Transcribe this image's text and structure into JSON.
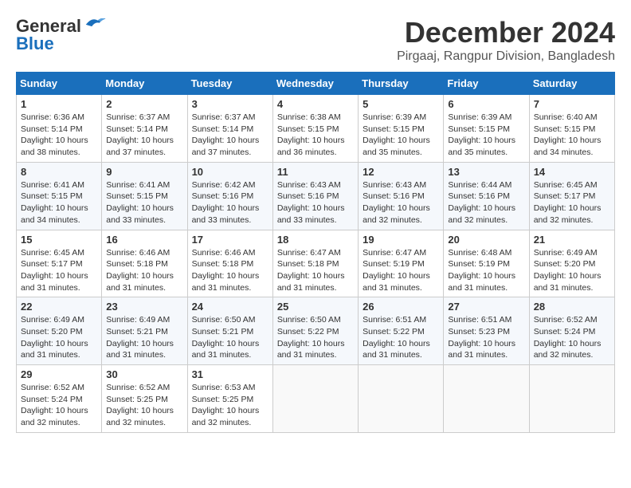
{
  "logo": {
    "line1": "General",
    "line2": "Blue"
  },
  "title": "December 2024",
  "location": "Pirgaaj, Rangpur Division, Bangladesh",
  "weekdays": [
    "Sunday",
    "Monday",
    "Tuesday",
    "Wednesday",
    "Thursday",
    "Friday",
    "Saturday"
  ],
  "weeks": [
    [
      {
        "day": "1",
        "info": "Sunrise: 6:36 AM\nSunset: 5:14 PM\nDaylight: 10 hours\nand 38 minutes."
      },
      {
        "day": "2",
        "info": "Sunrise: 6:37 AM\nSunset: 5:14 PM\nDaylight: 10 hours\nand 37 minutes."
      },
      {
        "day": "3",
        "info": "Sunrise: 6:37 AM\nSunset: 5:14 PM\nDaylight: 10 hours\nand 37 minutes."
      },
      {
        "day": "4",
        "info": "Sunrise: 6:38 AM\nSunset: 5:15 PM\nDaylight: 10 hours\nand 36 minutes."
      },
      {
        "day": "5",
        "info": "Sunrise: 6:39 AM\nSunset: 5:15 PM\nDaylight: 10 hours\nand 35 minutes."
      },
      {
        "day": "6",
        "info": "Sunrise: 6:39 AM\nSunset: 5:15 PM\nDaylight: 10 hours\nand 35 minutes."
      },
      {
        "day": "7",
        "info": "Sunrise: 6:40 AM\nSunset: 5:15 PM\nDaylight: 10 hours\nand 34 minutes."
      }
    ],
    [
      {
        "day": "8",
        "info": "Sunrise: 6:41 AM\nSunset: 5:15 PM\nDaylight: 10 hours\nand 34 minutes."
      },
      {
        "day": "9",
        "info": "Sunrise: 6:41 AM\nSunset: 5:15 PM\nDaylight: 10 hours\nand 33 minutes."
      },
      {
        "day": "10",
        "info": "Sunrise: 6:42 AM\nSunset: 5:16 PM\nDaylight: 10 hours\nand 33 minutes."
      },
      {
        "day": "11",
        "info": "Sunrise: 6:43 AM\nSunset: 5:16 PM\nDaylight: 10 hours\nand 33 minutes."
      },
      {
        "day": "12",
        "info": "Sunrise: 6:43 AM\nSunset: 5:16 PM\nDaylight: 10 hours\nand 32 minutes."
      },
      {
        "day": "13",
        "info": "Sunrise: 6:44 AM\nSunset: 5:16 PM\nDaylight: 10 hours\nand 32 minutes."
      },
      {
        "day": "14",
        "info": "Sunrise: 6:45 AM\nSunset: 5:17 PM\nDaylight: 10 hours\nand 32 minutes."
      }
    ],
    [
      {
        "day": "15",
        "info": "Sunrise: 6:45 AM\nSunset: 5:17 PM\nDaylight: 10 hours\nand 31 minutes."
      },
      {
        "day": "16",
        "info": "Sunrise: 6:46 AM\nSunset: 5:18 PM\nDaylight: 10 hours\nand 31 minutes."
      },
      {
        "day": "17",
        "info": "Sunrise: 6:46 AM\nSunset: 5:18 PM\nDaylight: 10 hours\nand 31 minutes."
      },
      {
        "day": "18",
        "info": "Sunrise: 6:47 AM\nSunset: 5:18 PM\nDaylight: 10 hours\nand 31 minutes."
      },
      {
        "day": "19",
        "info": "Sunrise: 6:47 AM\nSunset: 5:19 PM\nDaylight: 10 hours\nand 31 minutes."
      },
      {
        "day": "20",
        "info": "Sunrise: 6:48 AM\nSunset: 5:19 PM\nDaylight: 10 hours\nand 31 minutes."
      },
      {
        "day": "21",
        "info": "Sunrise: 6:49 AM\nSunset: 5:20 PM\nDaylight: 10 hours\nand 31 minutes."
      }
    ],
    [
      {
        "day": "22",
        "info": "Sunrise: 6:49 AM\nSunset: 5:20 PM\nDaylight: 10 hours\nand 31 minutes."
      },
      {
        "day": "23",
        "info": "Sunrise: 6:49 AM\nSunset: 5:21 PM\nDaylight: 10 hours\nand 31 minutes."
      },
      {
        "day": "24",
        "info": "Sunrise: 6:50 AM\nSunset: 5:21 PM\nDaylight: 10 hours\nand 31 minutes."
      },
      {
        "day": "25",
        "info": "Sunrise: 6:50 AM\nSunset: 5:22 PM\nDaylight: 10 hours\nand 31 minutes."
      },
      {
        "day": "26",
        "info": "Sunrise: 6:51 AM\nSunset: 5:22 PM\nDaylight: 10 hours\nand 31 minutes."
      },
      {
        "day": "27",
        "info": "Sunrise: 6:51 AM\nSunset: 5:23 PM\nDaylight: 10 hours\nand 31 minutes."
      },
      {
        "day": "28",
        "info": "Sunrise: 6:52 AM\nSunset: 5:24 PM\nDaylight: 10 hours\nand 32 minutes."
      }
    ],
    [
      {
        "day": "29",
        "info": "Sunrise: 6:52 AM\nSunset: 5:24 PM\nDaylight: 10 hours\nand 32 minutes."
      },
      {
        "day": "30",
        "info": "Sunrise: 6:52 AM\nSunset: 5:25 PM\nDaylight: 10 hours\nand 32 minutes."
      },
      {
        "day": "31",
        "info": "Sunrise: 6:53 AM\nSunset: 5:25 PM\nDaylight: 10 hours\nand 32 minutes."
      },
      {
        "day": "",
        "info": ""
      },
      {
        "day": "",
        "info": ""
      },
      {
        "day": "",
        "info": ""
      },
      {
        "day": "",
        "info": ""
      }
    ]
  ]
}
